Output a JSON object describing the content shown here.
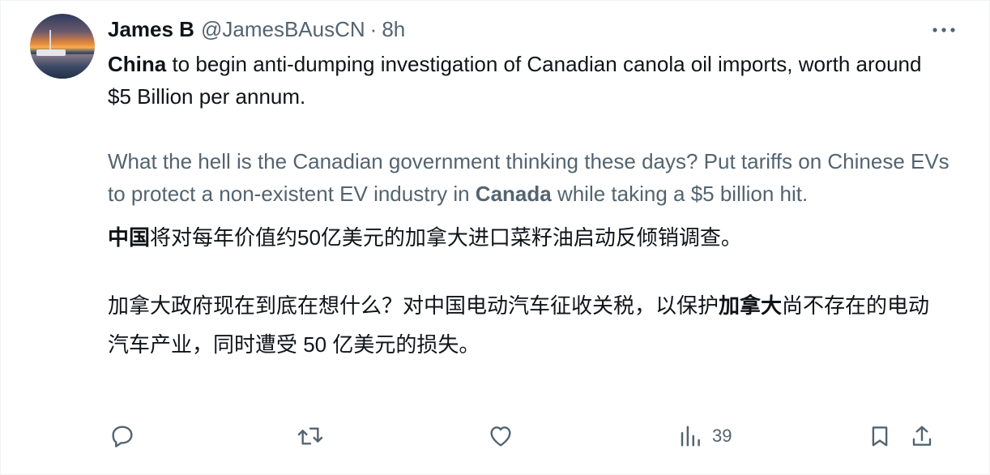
{
  "tweet": {
    "author_name": "James B",
    "author_handle": "@JamesBAusCN",
    "separator": "·",
    "time": "8h",
    "en_para1": {
      "bold": "China",
      "rest": " to begin anti-dumping investigation of Canadian canola oil imports, worth around $5 Billion per annum."
    },
    "en_para2": {
      "pre": "What the hell is the Canadian government thinking these days? Put tariffs on Chinese EVs to protect a non-existent EV industry in ",
      "bold": "Canada",
      "post": " while taking a $5 billion hit."
    },
    "zh_para1": {
      "bold": "中国",
      "rest": "将对每年价值约50亿美元的加拿大进口菜籽油启动反倾销调查。"
    },
    "zh_para2": {
      "pre": "加拿大政府现在到底在想什么？对中国电动汽车征收关税，以保护",
      "bold": "加拿大",
      "post": "尚不存在的电动汽车产业，同时遭受 50 亿美元的损失。"
    }
  },
  "actions": {
    "views_count": "39"
  },
  "icons": {
    "more": "more-horizontal-icon",
    "reply": "reply-icon",
    "retweet": "retweet-icon",
    "like": "heart-icon",
    "views": "views-bar-chart-icon",
    "bookmark": "bookmark-icon",
    "share": "share-icon"
  },
  "colors": {
    "text": "#0f1419",
    "secondary": "#536471",
    "border": "#eff3f4"
  }
}
